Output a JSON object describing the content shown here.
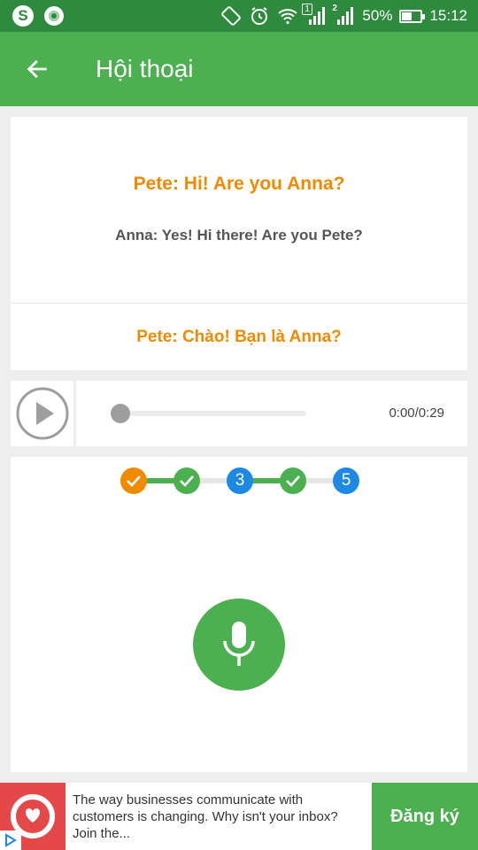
{
  "status_bar": {
    "battery": "50%",
    "battery_level": 0.5,
    "time": "15:12",
    "sim1_badge": "1",
    "sim2_badge": "2"
  },
  "app_bar": {
    "title": "Hội thoại",
    "back_icon": "arrow-left-icon"
  },
  "dialog": {
    "line_primary": "Pete: Hi! Are you Anna?",
    "line_secondary": "Anna: Yes! Hi there! Are you Pete?",
    "translation": "Pete: Chào! Bạn là Anna?"
  },
  "player": {
    "time": "0:00/0:29",
    "progress": 0
  },
  "steps": [
    {
      "label": "",
      "state": "done-current",
      "color": "#f08a00"
    },
    {
      "label": "",
      "state": "done",
      "color": "#4caf50"
    },
    {
      "label": "3",
      "state": "pending",
      "color": "#1e88e5"
    },
    {
      "label": "",
      "state": "done",
      "color": "#4caf50"
    },
    {
      "label": "5",
      "state": "pending",
      "color": "#1e88e5"
    }
  ],
  "ad": {
    "text": "The way businesses communicate with customers is changing. Why isn't your inbox? Join the...",
    "cta": "Đăng ký"
  },
  "colors": {
    "primary": "#4caf50",
    "status_bar": "#2e8b3d",
    "accent_orange": "#f08a00",
    "accent_blue": "#1e88e5"
  }
}
